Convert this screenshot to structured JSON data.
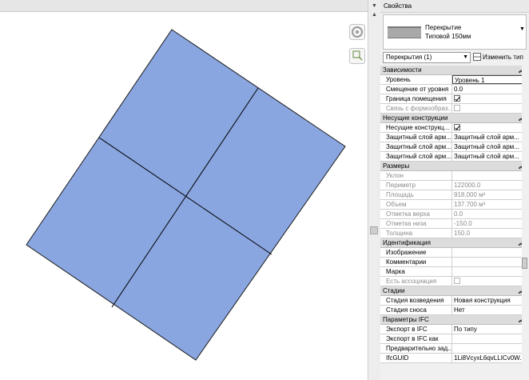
{
  "properties_panel": {
    "title": "Свойства",
    "type_family": "Перекрытие",
    "type_name": "Типовой 150мм",
    "filter": "Перекрытия (1)",
    "edit_type_label": "Изменить тип"
  },
  "sections": [
    {
      "title": "Зависимости",
      "rows": [
        {
          "label": "Уровень",
          "value": "Уровень 1",
          "kind": "edit"
        },
        {
          "label": "Смещение от уровня",
          "value": "0.0",
          "kind": "text"
        },
        {
          "label": "Граница помещения",
          "value": "",
          "kind": "check",
          "checked": true
        },
        {
          "label": "Связь с формообраз...",
          "value": "",
          "kind": "check",
          "checked": false,
          "disabled": true
        }
      ]
    },
    {
      "title": "Несущие конструкции",
      "rows": [
        {
          "label": "Несущие конструкц...",
          "value": "",
          "kind": "check",
          "checked": true
        },
        {
          "label": "Защитный слой арм...",
          "value": "Защитный слой арм...",
          "kind": "text"
        },
        {
          "label": "Защитный слой арм...",
          "value": "Защитный слой арм...",
          "kind": "text"
        },
        {
          "label": "Защитный слой арм...",
          "value": "Защитный слой арм...",
          "kind": "text"
        }
      ]
    },
    {
      "title": "Размеры",
      "rows": [
        {
          "label": "Уклон",
          "value": "",
          "kind": "text",
          "disabled": true
        },
        {
          "label": "Периметр",
          "value": "122000.0",
          "kind": "text",
          "disabled": true
        },
        {
          "label": "Площадь",
          "value": "918.000 м²",
          "kind": "text",
          "disabled": true
        },
        {
          "label": "Объем",
          "value": "137.700 м³",
          "kind": "text",
          "disabled": true
        },
        {
          "label": "Отметка верха",
          "value": "0.0",
          "kind": "text",
          "disabled": true
        },
        {
          "label": "Отметка низа",
          "value": "-150.0",
          "kind": "text",
          "disabled": true
        },
        {
          "label": "Толщина",
          "value": "150.0",
          "kind": "text",
          "disabled": true
        }
      ]
    },
    {
      "title": "Идентификация",
      "rows": [
        {
          "label": "Изображение",
          "value": "",
          "kind": "text"
        },
        {
          "label": "Комментарии",
          "value": "",
          "kind": "text"
        },
        {
          "label": "Марка",
          "value": "",
          "kind": "text"
        },
        {
          "label": "Есть ассоциация",
          "value": "",
          "kind": "check",
          "checked": false,
          "disabled": true
        }
      ]
    },
    {
      "title": "Стадии",
      "rows": [
        {
          "label": "Стадия возведения",
          "value": "Новая конструкция",
          "kind": "text"
        },
        {
          "label": "Стадия сноса",
          "value": "Нет",
          "kind": "text"
        }
      ]
    },
    {
      "title": "Параметры IFC",
      "rows": [
        {
          "label": "Экспорт в IFC",
          "value": "По типу",
          "kind": "text"
        },
        {
          "label": "Экспорт в IFC как",
          "value": "",
          "kind": "text"
        },
        {
          "label": "Предварительно зад...",
          "value": "",
          "kind": "text"
        },
        {
          "label": "IfcGUID",
          "value": "1Li8VcyxL6qvLLICv0W...",
          "kind": "text"
        }
      ]
    }
  ],
  "icons": {
    "collapse": "double-chevron-up-icon",
    "viewcube": "navigation-wheel-icon",
    "zoom": "zoom-region-icon"
  },
  "colors": {
    "slab_fill": "#8aa6e0",
    "slab_stroke": "#1a1a1a",
    "panel_bg": "#f0f0f0",
    "section_bg": "#dcdcdc"
  }
}
